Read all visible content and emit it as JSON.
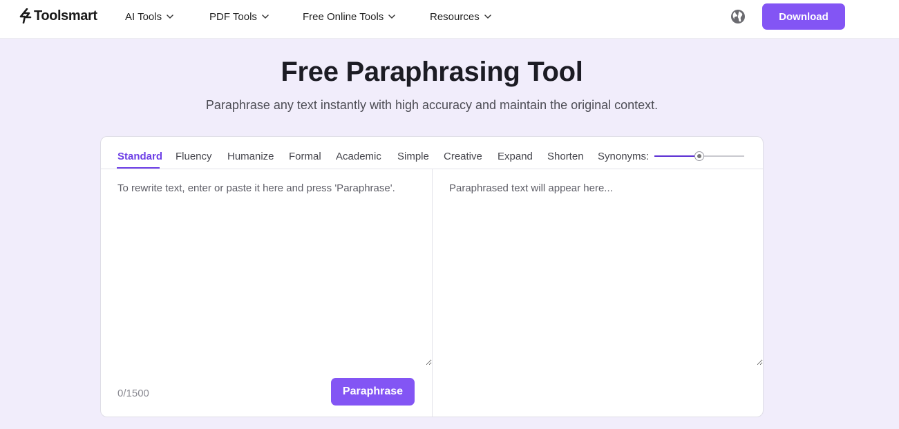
{
  "brand": {
    "logo_text": "Toolsmart",
    "accent_color": "#8355f4",
    "active_tab_color": "#6d3fe6",
    "page_background": "#f1edfb"
  },
  "header": {
    "nav": [
      {
        "label": "AI Tools",
        "icon": "chevron-down-icon"
      },
      {
        "label": "PDF Tools",
        "icon": "chevron-down-icon"
      },
      {
        "label": "Free Online Tools",
        "icon": "chevron-down-icon"
      },
      {
        "label": "Resources",
        "icon": "chevron-down-icon"
      }
    ],
    "language_icon": "globe-icon",
    "download_label": "Download"
  },
  "hero": {
    "title": "Free Paraphrasing Tool",
    "subtitle": "Paraphrase any text instantly with high accuracy and maintain the original context."
  },
  "tool": {
    "modes": [
      {
        "label": "Standard",
        "active": true
      },
      {
        "label": "Fluency",
        "active": false
      },
      {
        "label": "Humanize",
        "active": false
      },
      {
        "label": "Formal",
        "active": false
      },
      {
        "label": "Academic",
        "active": false
      },
      {
        "label": "Simple",
        "active": false
      },
      {
        "label": "Creative",
        "active": false
      },
      {
        "label": "Expand",
        "active": false
      },
      {
        "label": "Shorten",
        "active": false
      }
    ],
    "synonyms_label": "Synonyms:",
    "synonyms_level": 0.5,
    "input_placeholder": "To rewrite text, enter or paste it here and press 'Paraphrase'.",
    "output_placeholder": "Paraphrased text will appear here...",
    "char_count": "0/1500",
    "paraphrase_label": "Paraphrase"
  }
}
